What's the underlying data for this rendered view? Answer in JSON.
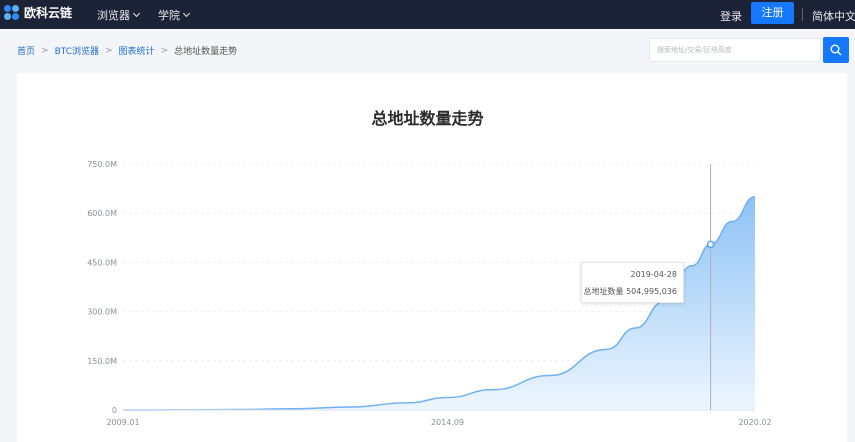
{
  "header": {
    "brand": "欧科云链",
    "nav": [
      {
        "label": "浏览器"
      },
      {
        "label": "学院"
      }
    ],
    "login_label": "登录",
    "register_label": "注册",
    "language_label": "简体中文"
  },
  "breadcrumb": {
    "items": [
      "首页",
      "BTC浏览器",
      "图表统计",
      "总地址数量走势"
    ],
    "separator": ">"
  },
  "search": {
    "placeholder": "搜索地址/交易/区块高度"
  },
  "chart": {
    "tooltip": {
      "date": "2019-04-28",
      "series_label": "总地址数量",
      "value": "504,995,036"
    }
  },
  "colors": {
    "nav_bg": "#1d2337",
    "accent": "#1677ff",
    "area_top": "#8ec2f5",
    "area_bottom": "#eef6fe"
  },
  "chart_data": {
    "type": "area",
    "title": "总地址数量走势",
    "xlabel": "",
    "ylabel": "",
    "xlim": [
      "2009.01",
      "2020.02"
    ],
    "ylim": [
      0,
      750000000
    ],
    "x_ticks": [
      "2009.01",
      "2014.09",
      "2020.02"
    ],
    "y_ticks": [
      "0",
      "150.0M",
      "300.0M",
      "450.0M",
      "600.0M",
      "750.0M"
    ],
    "y_tick_values": [
      0,
      150000000,
      300000000,
      450000000,
      600000000,
      750000000
    ],
    "grid": true,
    "x": [
      2009.0,
      2010.0,
      2011.0,
      2012.0,
      2013.0,
      2014.0,
      2014.7,
      2015.5,
      2016.5,
      2017.5,
      2018.0,
      2018.5,
      2019.0,
      2019.32,
      2019.7,
      2020.1
    ],
    "values": [
      0,
      300000,
      1500000,
      4000000,
      9000000,
      22000000,
      38000000,
      62000000,
      105000000,
      185000000,
      250000000,
      330000000,
      440000000,
      505000000,
      575000000,
      650000000
    ],
    "highlight": {
      "x": 2019.32,
      "label": "2019-04-28",
      "value": 504995036
    }
  }
}
